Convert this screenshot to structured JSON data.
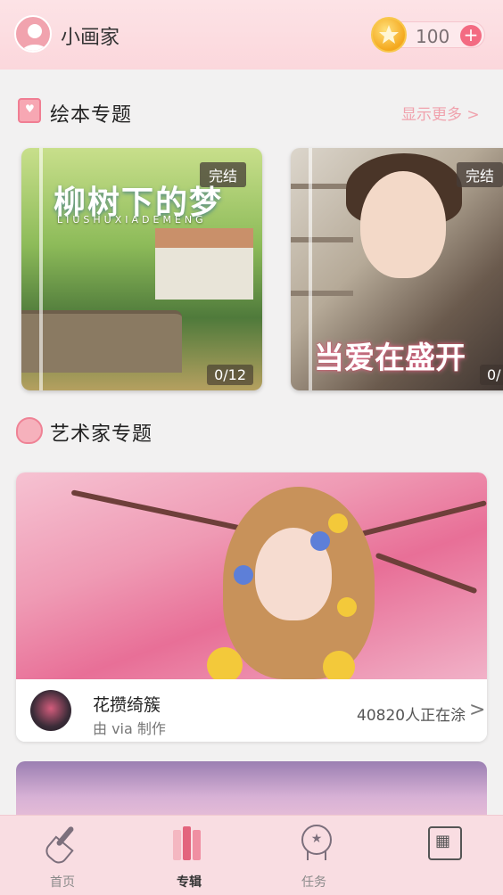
{
  "header": {
    "user_name": "小画家",
    "coins": "100",
    "plus": "+"
  },
  "picture_book_section": {
    "title": "绘本专题",
    "more": "显示更多 >",
    "books": [
      {
        "title_art": "柳树下的梦",
        "pinyin": "LIUSHUXIADEMENG",
        "badge": "完结",
        "progress": "0/12"
      },
      {
        "title_art": "当爱在盛开",
        "badge": "完结",
        "progress": "0/"
      }
    ]
  },
  "artist_section": {
    "title": "艺术家专题",
    "cards": [
      {
        "name": "花攒绮簇",
        "by": "由 via 制作",
        "count": "40820人正在涂",
        "chevron": ">"
      }
    ]
  },
  "bottom_nav": {
    "items": [
      {
        "label": "首页",
        "icon": "brush-icon",
        "active": false
      },
      {
        "label": "专辑",
        "icon": "books-icon",
        "active": true
      },
      {
        "label": "任务",
        "icon": "medal-icon",
        "active": false
      },
      {
        "label": "",
        "icon": "board-icon",
        "active": false
      }
    ]
  },
  "colors": {
    "accent": "#f36b82",
    "header_bg": "#fde3e6",
    "nav_bg": "#f9dde2",
    "more_link": "#f0a2ad"
  }
}
